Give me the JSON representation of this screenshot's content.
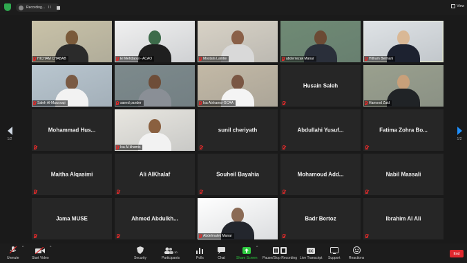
{
  "topbar": {
    "recording_label": "Recording...",
    "pause_glyph": "II",
    "view_label": "View"
  },
  "pages": {
    "left": "1/2",
    "right": "1/2"
  },
  "tiles": [
    {
      "name": "HICHAM CHABAB",
      "video": true,
      "label": true
    },
    {
      "name": "El Mehdaoui - ACAO",
      "video": true,
      "label": true
    },
    {
      "name": "Mostafa Lamtie",
      "video": true,
      "label": true
    },
    {
      "name": "abderrezak Manar",
      "video": true,
      "label": true
    },
    {
      "name": "Hitham Belmani",
      "video": true,
      "label": true,
      "active": true
    },
    {
      "name": "Saleh Al-Marzouqi",
      "video": true,
      "label": true
    },
    {
      "name": "saeed pander",
      "video": true,
      "label": true
    },
    {
      "name": "Isa Alshamsi-GCAA",
      "video": true,
      "label": true
    },
    {
      "name": "Husain Saleh",
      "video": false
    },
    {
      "name": "Hamood Zaid",
      "video": true,
      "label": true
    },
    {
      "name": "Mohammad Hus...",
      "video": false
    },
    {
      "name": "Isa Al khamis",
      "video": true,
      "label": true
    },
    {
      "name": "sunil cheriyath",
      "video": false
    },
    {
      "name": "Abdullahi Yusuf...",
      "video": false
    },
    {
      "name": "Fatima Zohra Bo...",
      "video": false
    },
    {
      "name": "Maitha Alqasimi",
      "video": false
    },
    {
      "name": "Ali AlKhalaf",
      "video": false
    },
    {
      "name": "Souheil Bayahia",
      "video": false
    },
    {
      "name": "Mohamoud Add...",
      "video": false
    },
    {
      "name": "Nabil Massali",
      "video": false
    },
    {
      "name": "Jama MUSE",
      "video": false
    },
    {
      "name": "Ahmed Abdulkh...",
      "video": false
    },
    {
      "name": "Abdelmalek Manar",
      "video": true,
      "label": true
    },
    {
      "name": "Badr Bertoz",
      "video": false
    },
    {
      "name": "Ibrahim Al Ali",
      "video": false
    }
  ],
  "toolbar": {
    "unmute": "Unmute",
    "start_video": "Start Video",
    "security": "Security",
    "participants": "Participants",
    "participants_count": "30",
    "polls": "Polls",
    "chat": "Chat",
    "share_screen": "Share Screen",
    "pause_stop_recording": "Pause/Stop Recording",
    "live_transcript": "Live Transcript",
    "cc_glyph": "CC",
    "support": "Support",
    "reactions": "Reactions",
    "end": "End"
  },
  "colors": {
    "accent_green": "#2ecc40",
    "end_red": "#e0282e",
    "active_border": "#b8c24a",
    "arrow_blue": "#1e90ff",
    "mute_red": "#e02a2a"
  }
}
